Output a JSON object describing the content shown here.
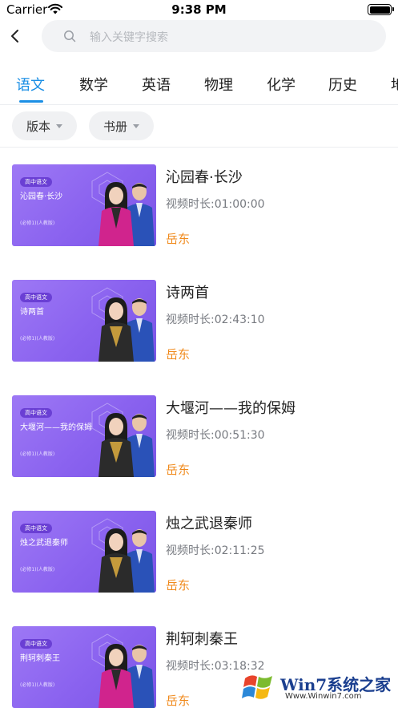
{
  "status_bar": {
    "carrier": "Carrier",
    "time": "9:38 PM"
  },
  "search": {
    "placeholder": "输入关键字搜索"
  },
  "tabs": [
    {
      "label": "语文",
      "active": true
    },
    {
      "label": "数学",
      "active": false
    },
    {
      "label": "英语",
      "active": false
    },
    {
      "label": "物理",
      "active": false
    },
    {
      "label": "化学",
      "active": false
    },
    {
      "label": "历史",
      "active": false
    },
    {
      "label": "地",
      "active": false
    }
  ],
  "filters": {
    "edition": "版本",
    "volume": "书册"
  },
  "courses": [
    {
      "thumb_badge": "高中语文",
      "thumb_title": "沁园春·长沙",
      "thumb_sub": "(必修1)(人教版)",
      "title": "沁园春·长沙",
      "duration": "视频时长:01:00:00",
      "teacher": "岳东"
    },
    {
      "thumb_badge": "高中语文",
      "thumb_title": "诗两首",
      "thumb_sub": "(必修1)(人教版)",
      "title": "诗两首",
      "duration": "视频时长:02:43:10",
      "teacher": "岳东"
    },
    {
      "thumb_badge": "高中语文",
      "thumb_title": "大堰河——我的保姆",
      "thumb_sub": "(必修1)(人教版)",
      "title": "大堰河——我的保姆",
      "duration": "视频时长:00:51:30",
      "teacher": "岳东"
    },
    {
      "thumb_badge": "高中语文",
      "thumb_title": "烛之武退秦师",
      "thumb_sub": "(必修1)(人教版)",
      "title": "烛之武退秦师",
      "duration": "视频时长:02:11:25",
      "teacher": "岳东"
    },
    {
      "thumb_badge": "高中语文",
      "thumb_title": "荆轲刺秦王",
      "thumb_sub": "(必修1)(人教版)",
      "title": "荆轲刺秦王",
      "duration": "视频时长:03:18:32",
      "teacher": "岳东"
    }
  ],
  "watermark": {
    "brand": "Win7系统之家",
    "url": "Www.Winwin7.com"
  },
  "colors": {
    "accent": "#1b8fe5",
    "teacher": "#f08a1c",
    "thumb_purple": "#8a62ef"
  },
  "icons": {
    "back": "chevron-left-icon",
    "search": "search-icon",
    "filter_caret": "caret-down-icon"
  }
}
